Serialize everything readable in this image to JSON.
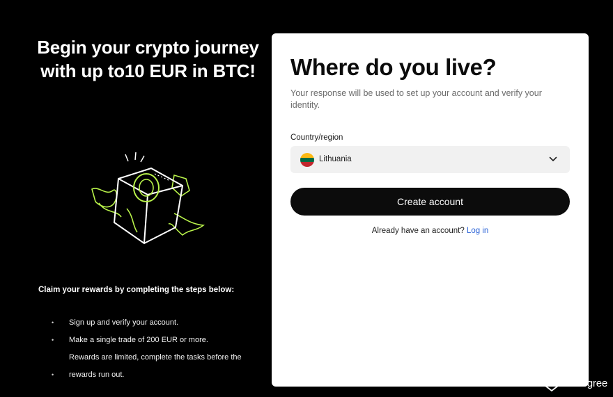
{
  "promo": {
    "title": "Begin your crypto journey with up to10 EUR in BTC!",
    "rewards_heading": "Claim your rewards by completing the steps below:",
    "steps": [
      "Sign up and verify your account.",
      "Make a single trade of  200  EUR or more."
    ],
    "step_continuation": "Rewards are limited, complete the tasks before the",
    "last_step": "rewards run out.",
    "bullet_char": "•"
  },
  "form": {
    "title": "Where do you live?",
    "subtitle": "Your response will be used to set up your account and verify your identity.",
    "country_label": "Country/region",
    "country_value": "Lithuania",
    "flag_colors": [
      "#fdb913",
      "#006a44",
      "#c1272d"
    ],
    "flag_icon": "lithuania-flag-icon",
    "dropdown_icon": "chevron-down-icon",
    "create_button": "Create account",
    "login_prompt": "Already have an account?",
    "login_link": "Log in"
  },
  "watermark": {
    "text": "BitDegree",
    "icon": "bitdegree-logo-icon"
  },
  "colors": {
    "accent_green": "#b8f24a",
    "link_blue": "#2a62d6",
    "button_black": "#0c0c0c",
    "select_bg": "#f1f1f1"
  }
}
